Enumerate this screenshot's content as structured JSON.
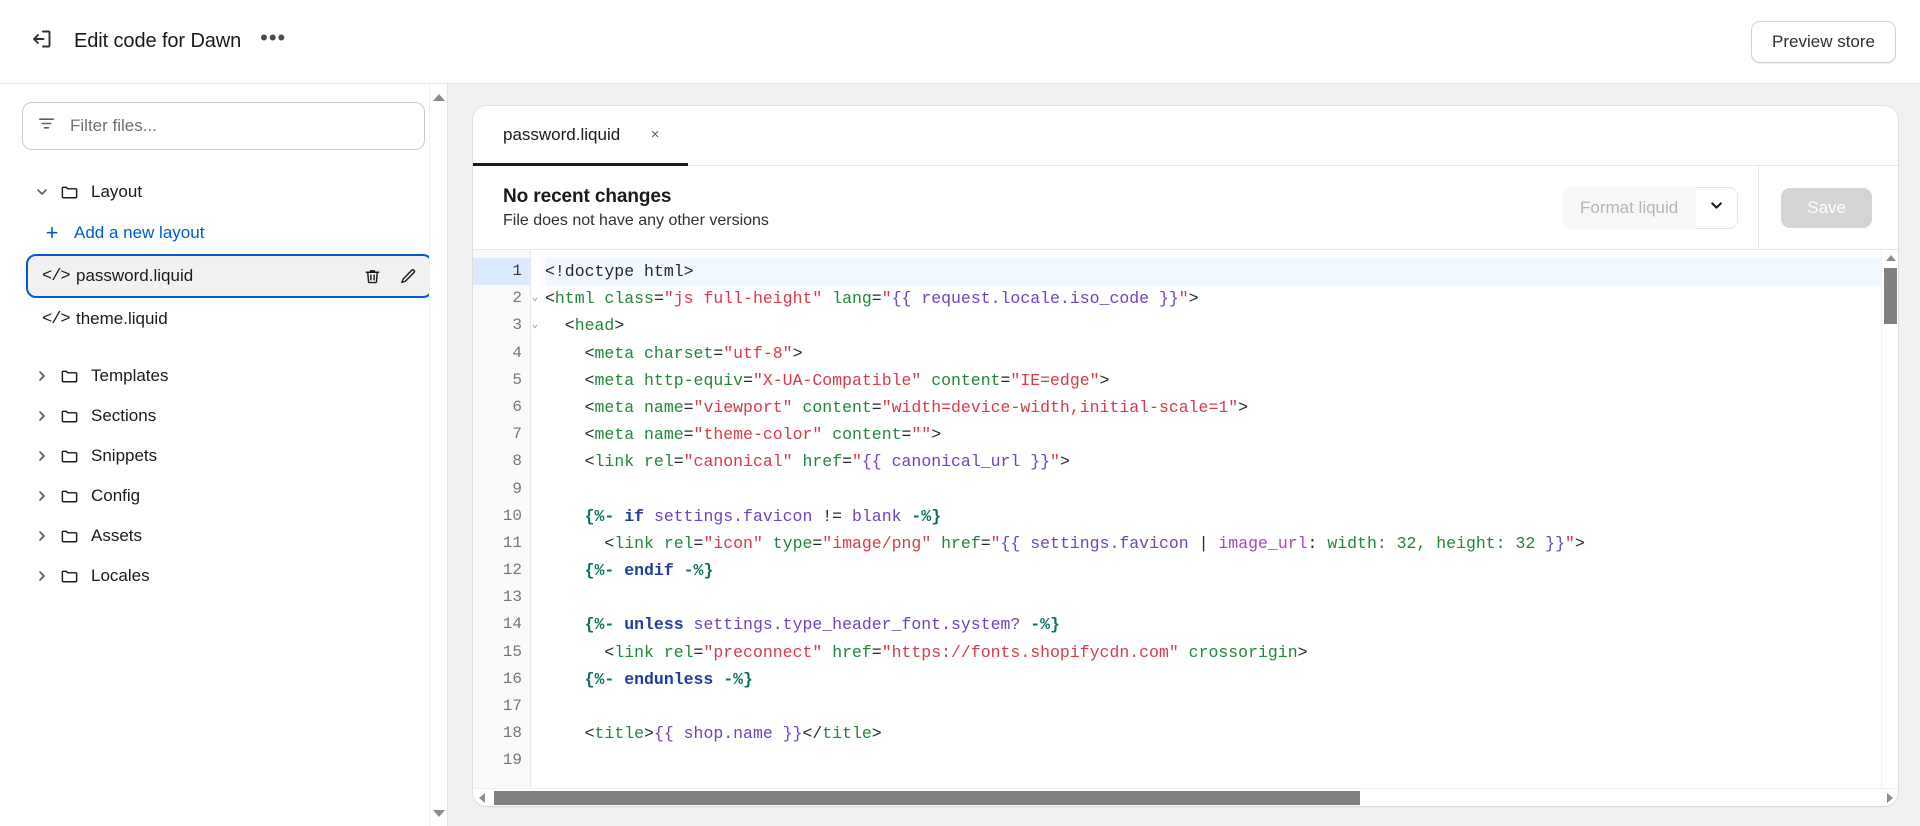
{
  "header": {
    "exit_icon": "exit-icon",
    "title": "Edit code for Dawn",
    "more_label": "•••",
    "preview_button": "Preview store"
  },
  "sidebar": {
    "filter": {
      "icon": "filter-icon",
      "placeholder": "Filter files...",
      "value": ""
    },
    "tree": [
      {
        "type": "folder",
        "label": "Layout",
        "expanded": true,
        "twisty": "chevron-down-icon",
        "children": [
          {
            "type": "add",
            "label": "Add a new layout",
            "icon": "plus-icon"
          },
          {
            "type": "file",
            "label": "password.liquid",
            "icon": "code-icon",
            "selected": true,
            "actions": [
              {
                "name": "delete-icon"
              },
              {
                "name": "rename-icon"
              }
            ]
          },
          {
            "type": "file",
            "label": "theme.liquid",
            "icon": "code-icon",
            "selected": false
          }
        ]
      },
      {
        "type": "folder",
        "label": "Templates",
        "expanded": false,
        "twisty": "chevron-right-icon"
      },
      {
        "type": "folder",
        "label": "Sections",
        "expanded": false,
        "twisty": "chevron-right-icon"
      },
      {
        "type": "folder",
        "label": "Snippets",
        "expanded": false,
        "twisty": "chevron-right-icon"
      },
      {
        "type": "folder",
        "label": "Config",
        "expanded": false,
        "twisty": "chevron-right-icon"
      },
      {
        "type": "folder",
        "label": "Assets",
        "expanded": false,
        "twisty": "chevron-right-icon"
      },
      {
        "type": "folder",
        "label": "Locales",
        "expanded": false,
        "twisty": "chevron-right-icon"
      }
    ]
  },
  "editor": {
    "tabs": [
      {
        "label": "password.liquid",
        "active": true,
        "close_label": "×"
      }
    ],
    "version_info": {
      "title": "No recent changes",
      "subtitle": "File does not have any other versions"
    },
    "toolbar": {
      "format_label": "Format liquid",
      "format_disabled": true,
      "caret_icon": "chevron-down-icon",
      "save_label": "Save",
      "save_disabled": true
    },
    "active_line": 1,
    "fold_lines": [
      2,
      3
    ],
    "line_count": 19,
    "lines": [
      {
        "n": 1,
        "tokens": [
          {
            "t": "punc",
            "v": "<!doctype html>"
          }
        ]
      },
      {
        "n": 2,
        "tokens": [
          {
            "t": "punc",
            "v": "<"
          },
          {
            "t": "tag",
            "v": "html"
          },
          {
            "t": "plain",
            "v": " "
          },
          {
            "t": "attr",
            "v": "class"
          },
          {
            "t": "punc",
            "v": "="
          },
          {
            "t": "str",
            "v": "\"js full-height\""
          },
          {
            "t": "plain",
            "v": " "
          },
          {
            "t": "attr",
            "v": "lang"
          },
          {
            "t": "punc",
            "v": "="
          },
          {
            "t": "str",
            "v": "\""
          },
          {
            "t": "var",
            "v": "{{ request.locale.iso_code }}"
          },
          {
            "t": "str",
            "v": "\""
          },
          {
            "t": "punc",
            "v": ">"
          }
        ]
      },
      {
        "n": 3,
        "tokens": [
          {
            "t": "punc",
            "v": "  <"
          },
          {
            "t": "tag",
            "v": "head"
          },
          {
            "t": "punc",
            "v": ">"
          }
        ]
      },
      {
        "n": 4,
        "tokens": [
          {
            "t": "punc",
            "v": "    <"
          },
          {
            "t": "tag",
            "v": "meta"
          },
          {
            "t": "plain",
            "v": " "
          },
          {
            "t": "attr",
            "v": "charset"
          },
          {
            "t": "punc",
            "v": "="
          },
          {
            "t": "str",
            "v": "\"utf-8\""
          },
          {
            "t": "punc",
            "v": ">"
          }
        ]
      },
      {
        "n": 5,
        "tokens": [
          {
            "t": "punc",
            "v": "    <"
          },
          {
            "t": "tag",
            "v": "meta"
          },
          {
            "t": "plain",
            "v": " "
          },
          {
            "t": "attr",
            "v": "http-equiv"
          },
          {
            "t": "punc",
            "v": "="
          },
          {
            "t": "str",
            "v": "\"X-UA-Compatible\""
          },
          {
            "t": "plain",
            "v": " "
          },
          {
            "t": "attr",
            "v": "content"
          },
          {
            "t": "punc",
            "v": "="
          },
          {
            "t": "str",
            "v": "\"IE=edge\""
          },
          {
            "t": "punc",
            "v": ">"
          }
        ]
      },
      {
        "n": 6,
        "tokens": [
          {
            "t": "punc",
            "v": "    <"
          },
          {
            "t": "tag",
            "v": "meta"
          },
          {
            "t": "plain",
            "v": " "
          },
          {
            "t": "attr",
            "v": "name"
          },
          {
            "t": "punc",
            "v": "="
          },
          {
            "t": "str",
            "v": "\"viewport\""
          },
          {
            "t": "plain",
            "v": " "
          },
          {
            "t": "attr",
            "v": "content"
          },
          {
            "t": "punc",
            "v": "="
          },
          {
            "t": "str",
            "v": "\"width=device-width,initial-scale=1\""
          },
          {
            "t": "punc",
            "v": ">"
          }
        ]
      },
      {
        "n": 7,
        "tokens": [
          {
            "t": "punc",
            "v": "    <"
          },
          {
            "t": "tag",
            "v": "meta"
          },
          {
            "t": "plain",
            "v": " "
          },
          {
            "t": "attr",
            "v": "name"
          },
          {
            "t": "punc",
            "v": "="
          },
          {
            "t": "str",
            "v": "\"theme-color\""
          },
          {
            "t": "plain",
            "v": " "
          },
          {
            "t": "attr",
            "v": "content"
          },
          {
            "t": "punc",
            "v": "="
          },
          {
            "t": "str",
            "v": "\"\""
          },
          {
            "t": "punc",
            "v": ">"
          }
        ]
      },
      {
        "n": 8,
        "tokens": [
          {
            "t": "punc",
            "v": "    <"
          },
          {
            "t": "tag",
            "v": "link"
          },
          {
            "t": "plain",
            "v": " "
          },
          {
            "t": "attr",
            "v": "rel"
          },
          {
            "t": "punc",
            "v": "="
          },
          {
            "t": "str",
            "v": "\"canonical\""
          },
          {
            "t": "plain",
            "v": " "
          },
          {
            "t": "attr",
            "v": "href"
          },
          {
            "t": "punc",
            "v": "="
          },
          {
            "t": "str",
            "v": "\""
          },
          {
            "t": "var",
            "v": "{{ canonical_url }}"
          },
          {
            "t": "str",
            "v": "\""
          },
          {
            "t": "punc",
            "v": ">"
          }
        ]
      },
      {
        "n": 9,
        "tokens": [
          {
            "t": "plain",
            "v": ""
          }
        ]
      },
      {
        "n": 10,
        "tokens": [
          {
            "t": "liq",
            "v": "    {%-"
          },
          {
            "t": "plain",
            "v": " "
          },
          {
            "t": "kw",
            "v": "if"
          },
          {
            "t": "plain",
            "v": " "
          },
          {
            "t": "var",
            "v": "settings.favicon"
          },
          {
            "t": "punc",
            "v": " != "
          },
          {
            "t": "var",
            "v": "blank"
          },
          {
            "t": "plain",
            "v": " "
          },
          {
            "t": "liq",
            "v": "-%}"
          }
        ]
      },
      {
        "n": 11,
        "tokens": [
          {
            "t": "punc",
            "v": "      <"
          },
          {
            "t": "tag",
            "v": "link"
          },
          {
            "t": "plain",
            "v": " "
          },
          {
            "t": "attr",
            "v": "rel"
          },
          {
            "t": "punc",
            "v": "="
          },
          {
            "t": "str",
            "v": "\"icon\""
          },
          {
            "t": "plain",
            "v": " "
          },
          {
            "t": "attr",
            "v": "type"
          },
          {
            "t": "punc",
            "v": "="
          },
          {
            "t": "str",
            "v": "\"image/png\""
          },
          {
            "t": "plain",
            "v": " "
          },
          {
            "t": "attr",
            "v": "href"
          },
          {
            "t": "punc",
            "v": "="
          },
          {
            "t": "str",
            "v": "\""
          },
          {
            "t": "var",
            "v": "{{ settings.favicon "
          },
          {
            "t": "punc",
            "v": "| "
          },
          {
            "t": "filter",
            "v": "image_url"
          },
          {
            "t": "punc",
            "v": ": "
          },
          {
            "t": "num",
            "v": "width: 32, height: 32"
          },
          {
            "t": "var",
            "v": " }}"
          },
          {
            "t": "str",
            "v": "\""
          },
          {
            "t": "punc",
            "v": ">"
          }
        ]
      },
      {
        "n": 12,
        "tokens": [
          {
            "t": "liq",
            "v": "    {%-"
          },
          {
            "t": "plain",
            "v": " "
          },
          {
            "t": "kw",
            "v": "endif"
          },
          {
            "t": "plain",
            "v": " "
          },
          {
            "t": "liq",
            "v": "-%}"
          }
        ]
      },
      {
        "n": 13,
        "tokens": [
          {
            "t": "plain",
            "v": ""
          }
        ]
      },
      {
        "n": 14,
        "tokens": [
          {
            "t": "liq",
            "v": "    {%-"
          },
          {
            "t": "plain",
            "v": " "
          },
          {
            "t": "kw",
            "v": "unless"
          },
          {
            "t": "plain",
            "v": " "
          },
          {
            "t": "var",
            "v": "settings.type_header_font.system?"
          },
          {
            "t": "plain",
            "v": " "
          },
          {
            "t": "liq",
            "v": "-%}"
          }
        ]
      },
      {
        "n": 15,
        "tokens": [
          {
            "t": "punc",
            "v": "      <"
          },
          {
            "t": "tag",
            "v": "link"
          },
          {
            "t": "plain",
            "v": " "
          },
          {
            "t": "attr",
            "v": "rel"
          },
          {
            "t": "punc",
            "v": "="
          },
          {
            "t": "str",
            "v": "\"preconnect\""
          },
          {
            "t": "plain",
            "v": " "
          },
          {
            "t": "attr",
            "v": "href"
          },
          {
            "t": "punc",
            "v": "="
          },
          {
            "t": "str",
            "v": "\"https://fonts.shopifycdn.com\""
          },
          {
            "t": "plain",
            "v": " "
          },
          {
            "t": "attr",
            "v": "crossorigin"
          },
          {
            "t": "punc",
            "v": ">"
          }
        ]
      },
      {
        "n": 16,
        "tokens": [
          {
            "t": "liq",
            "v": "    {%-"
          },
          {
            "t": "plain",
            "v": " "
          },
          {
            "t": "kw",
            "v": "endunless"
          },
          {
            "t": "plain",
            "v": " "
          },
          {
            "t": "liq",
            "v": "-%}"
          }
        ]
      },
      {
        "n": 17,
        "tokens": [
          {
            "t": "plain",
            "v": ""
          }
        ]
      },
      {
        "n": 18,
        "tokens": [
          {
            "t": "punc",
            "v": "    <"
          },
          {
            "t": "tag",
            "v": "title"
          },
          {
            "t": "punc",
            "v": ">"
          },
          {
            "t": "var",
            "v": "{{ shop.name }}"
          },
          {
            "t": "punc",
            "v": "</"
          },
          {
            "t": "tag",
            "v": "title"
          },
          {
            "t": "punc",
            "v": ">"
          }
        ]
      },
      {
        "n": 19,
        "tokens": [
          {
            "t": "plain",
            "v": ""
          }
        ]
      }
    ],
    "scrollbars": {
      "vertical_thumb_name": "editor-vertical-scrollbar",
      "horizontal_thumb_name": "editor-horizontal-scrollbar"
    }
  },
  "colors": {
    "accent": "#005bd3",
    "selected_border": "#005bd3",
    "active_line": "#dbeafe",
    "tab_underline": "#1a1a1a",
    "page_bg": "#f1f1f1"
  }
}
